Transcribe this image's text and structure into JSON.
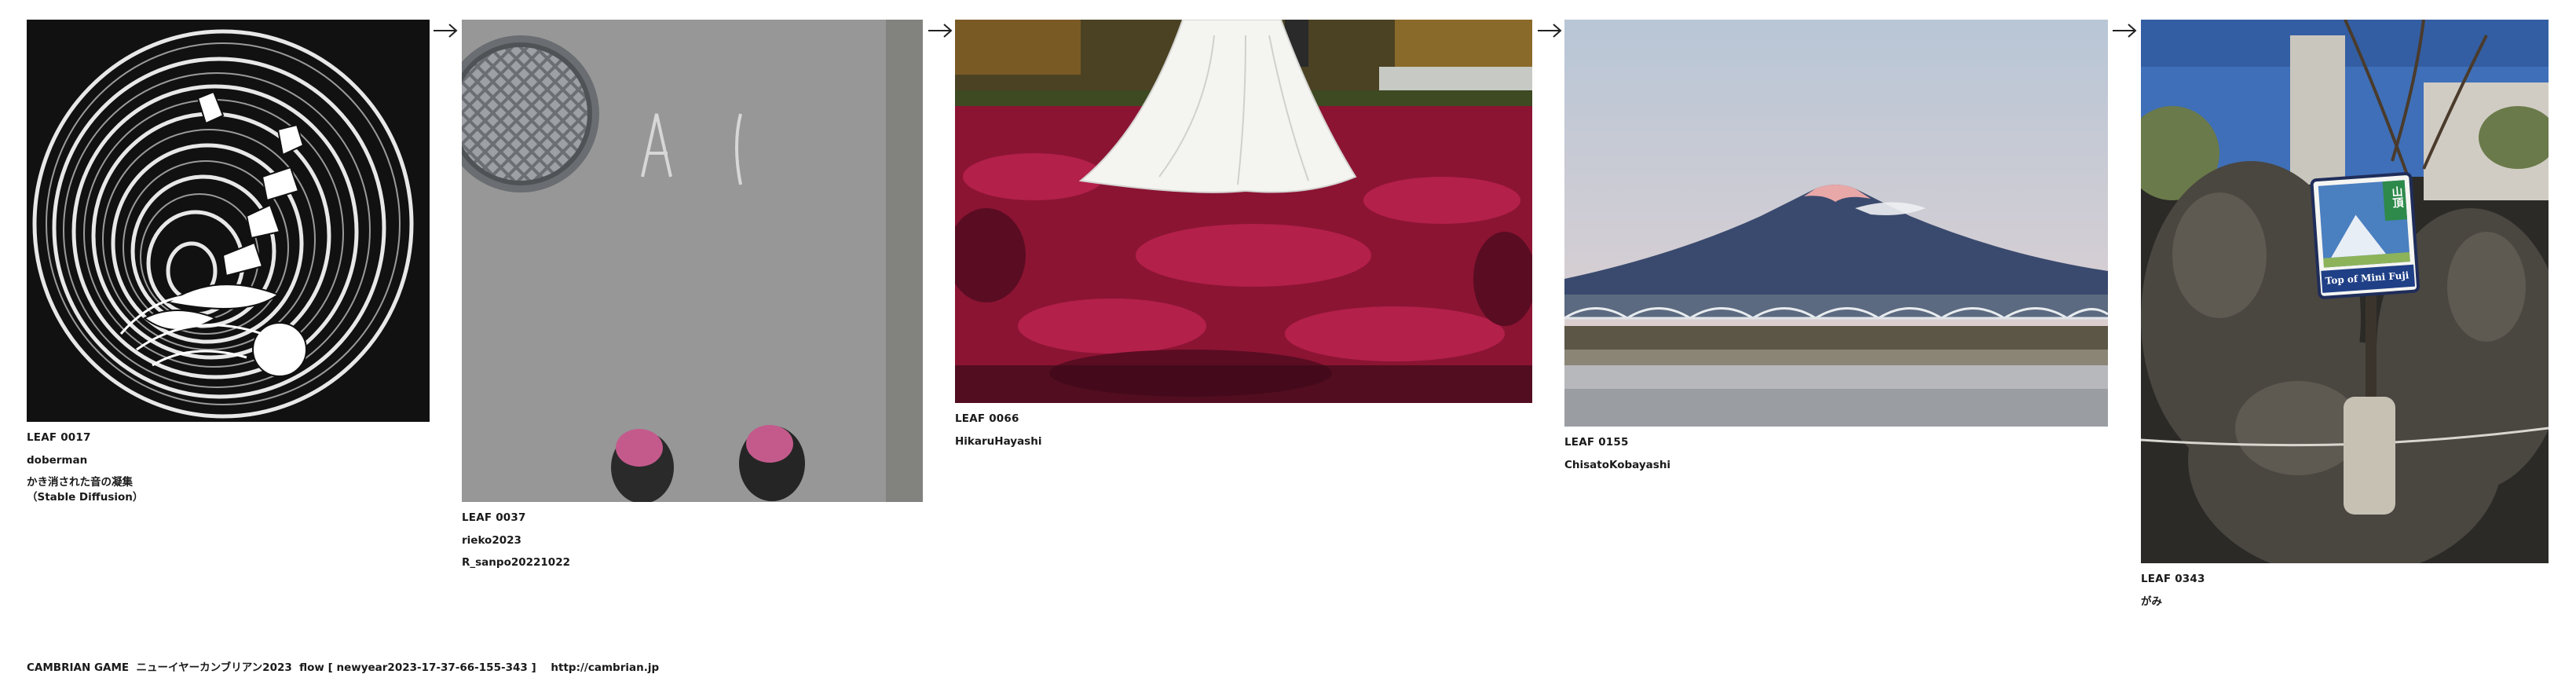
{
  "leaves": [
    {
      "code": "LEAF 0017",
      "author": "doberman",
      "title": "かき消された音の凝集\n（Stable Diffusion）",
      "image": "abstract-ink-drawing"
    },
    {
      "code": "LEAF 0037",
      "author": "rieko2023",
      "title": "R_sanpo20221022",
      "image": "asphalt-manhole-pink-shoes"
    },
    {
      "code": "LEAF 0066",
      "author": "HikaruHayashi",
      "title": "",
      "image": "wedding-dress-red-leaves"
    },
    {
      "code": "LEAF 0155",
      "author": "ChisatoKobayashi",
      "title": "",
      "image": "mount-fuji-sunset-bridge"
    },
    {
      "code": "LEAF 0343",
      "author": "がみ",
      "title": "",
      "image": "mini-fuji-shrine-sign",
      "sign_text": "Top of Mini Fuji",
      "sign_kanji": "山頂"
    }
  ],
  "arrow_icon": "right-arrow-icon",
  "footer": {
    "text": "CAMBRIAN GAME  ニューイヤーカンブリアン2023  flow [ newyear2023-17-37-66-155-343 ]    http://cambrian.jp"
  }
}
